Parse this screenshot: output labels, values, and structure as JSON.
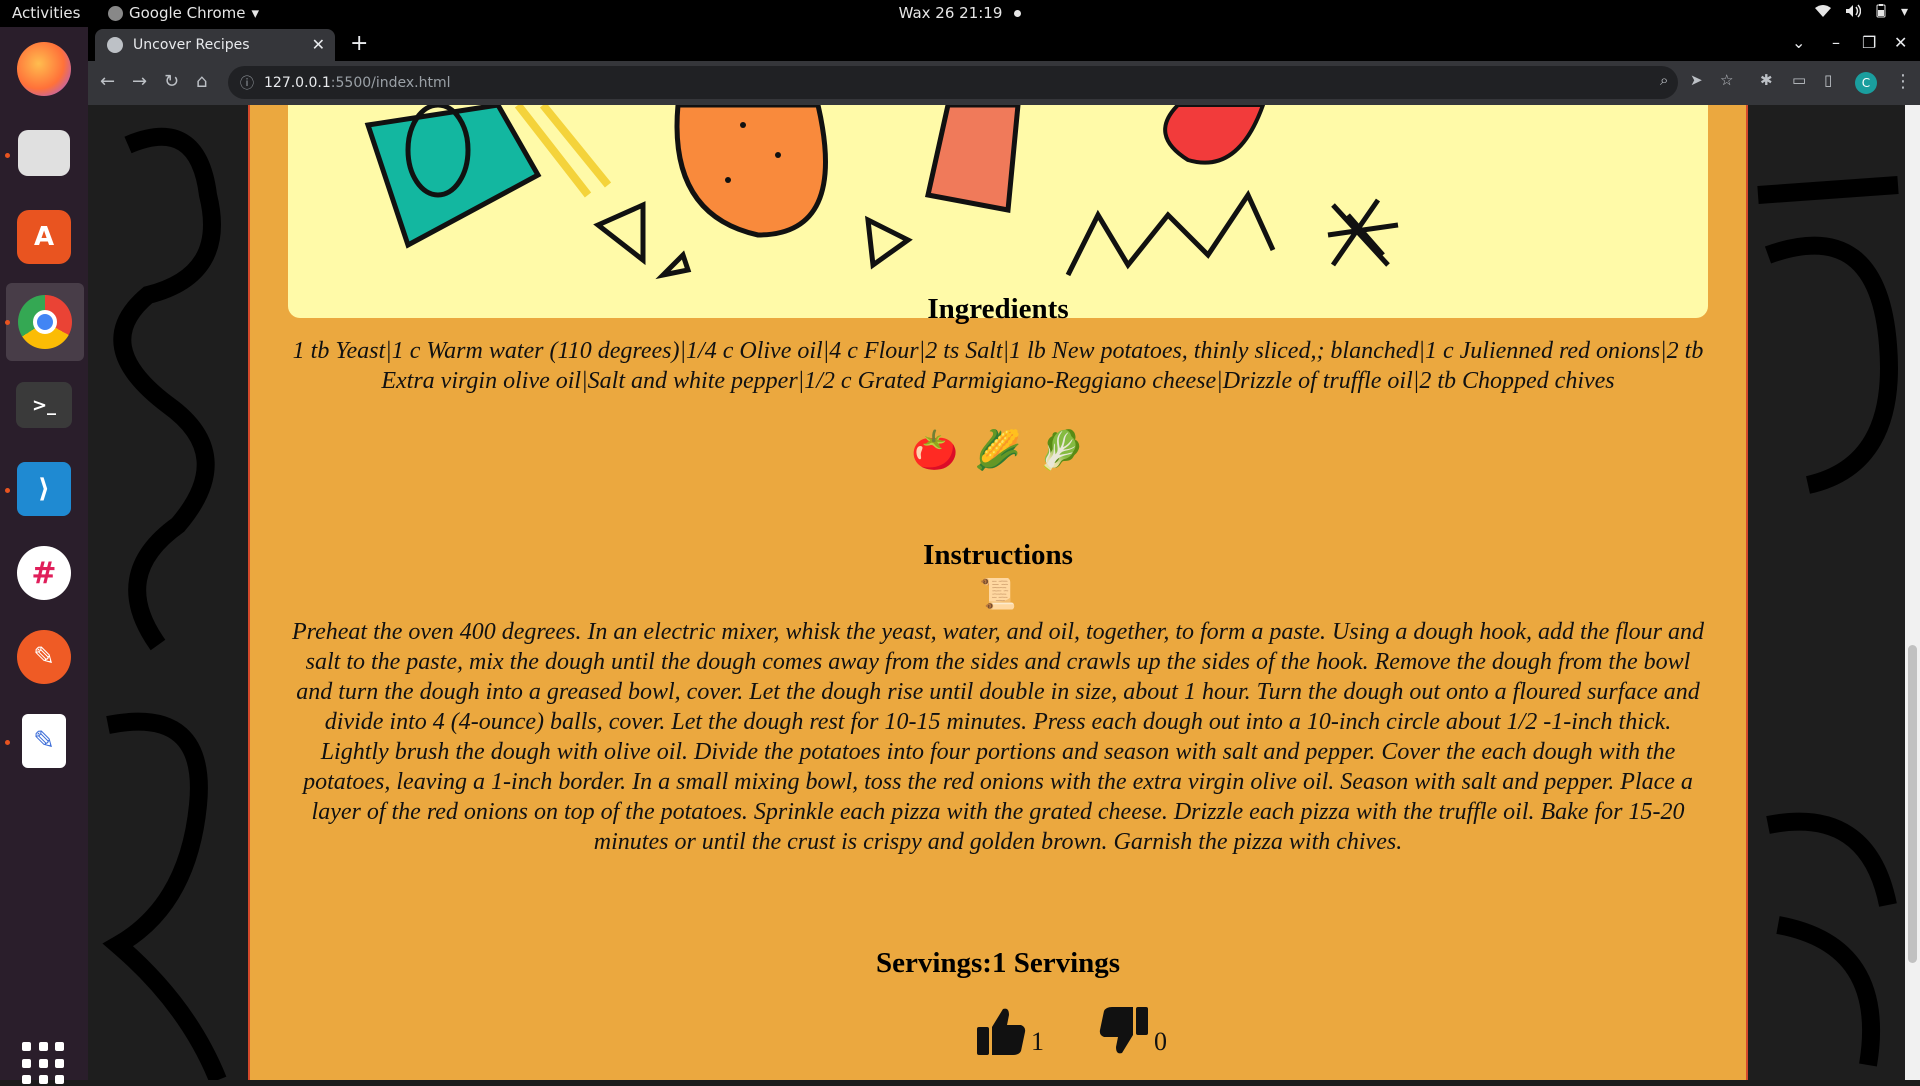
{
  "topbar": {
    "activities": "Activities",
    "app_name": "Google Chrome",
    "clock": "Wax 26  21:19"
  },
  "dock": {
    "items": [
      {
        "name": "firefox",
        "color": "#ff7139"
      },
      {
        "name": "files",
        "color": "#d9d9d9"
      },
      {
        "name": "software",
        "color": "#e95420"
      },
      {
        "name": "chrome",
        "color": "#4285f4"
      },
      {
        "name": "terminal",
        "color": "#3a3a3a"
      },
      {
        "name": "vscode",
        "color": "#1f8ad2"
      },
      {
        "name": "slack",
        "color": "#ffffff"
      },
      {
        "name": "postman",
        "color": "#ef5b25"
      },
      {
        "name": "text-editor",
        "color": "#ffffff"
      }
    ]
  },
  "browser": {
    "tab_title": "Uncover Recipes",
    "url_host": "127.0.0.1",
    "url_path": ":5500/index.html",
    "profile_initial": "C"
  },
  "recipe": {
    "ingredients_heading": "Ingredients",
    "ingredients_text": "1 tb Yeast|1 c Warm water (110 degrees)|1/4 c Olive oil|4 c Flour|2 ts Salt|1 lb New potatoes, thinly sliced,; blanched|1 c Julienned red onions|2 tb Extra virgin olive oil|Salt and white pepper|1/2 c Grated Parmigiano-Reggiano cheese|Drizzle of truffle oil|2 tb Chopped chives",
    "ingredient_emojis": [
      "🍅",
      "🌽",
      "🥬"
    ],
    "instructions_heading": "Instructions",
    "instructions_emoji": "📜",
    "instructions_text": "Preheat the oven 400 degrees. In an electric mixer, whisk the yeast, water, and oil, together, to form a paste. Using a dough hook, add the flour and salt to the paste, mix the dough until the dough comes away from the sides and crawls up the sides of the hook. Remove the dough from the bowl and turn the dough into a greased bowl, cover. Let the dough rise until double in size, about 1 hour. Turn the dough out onto a floured surface and divide into 4 (4-ounce) balls, cover. Let the dough rest for 10-15 minutes. Press each dough out into a 10-inch circle about 1/2 -1-inch thick. Lightly brush the dough with olive oil. Divide the potatoes into four portions and season with salt and pepper. Cover the each dough with the potatoes, leaving a 1-inch border. In a small mixing bowl, toss the red onions with the extra virgin olive oil. Season with salt and pepper. Place a layer of the red onions on top of the potatoes. Sprinkle each pizza with the grated cheese. Drizzle each pizza with the truffle oil. Bake for 15-20 minutes or until the crust is crispy and golden brown. Garnish the pizza with chives.",
    "servings": "Servings:1 Servings",
    "likes": "1",
    "dislikes": "0"
  }
}
